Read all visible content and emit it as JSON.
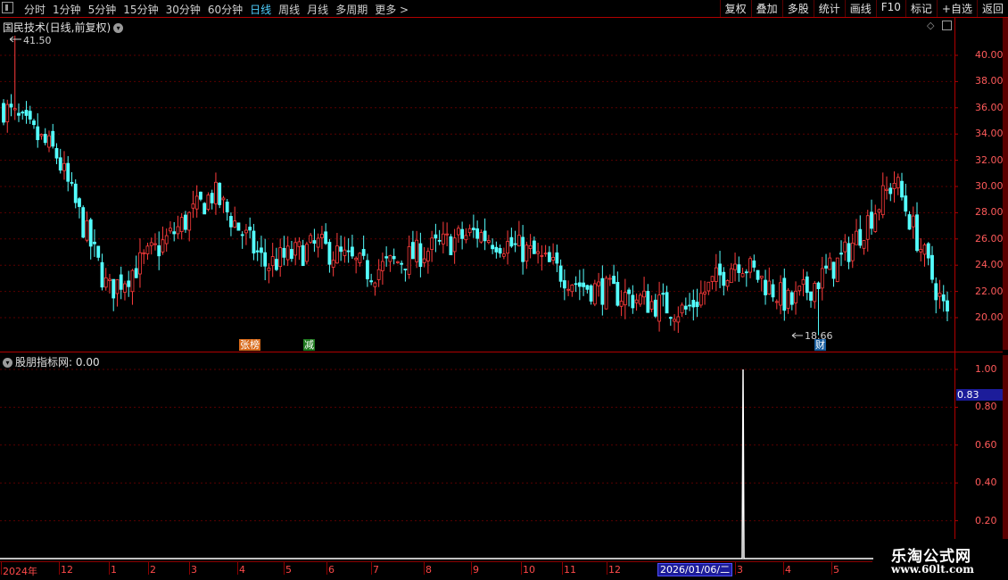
{
  "toolbar": {
    "periods": [
      "分时",
      "1分钟",
      "5分钟",
      "15分钟",
      "30分钟",
      "60分钟",
      "日线",
      "周线",
      "月线",
      "多周期",
      "更多 >"
    ],
    "active_period": "日线",
    "tools": [
      "复权",
      "叠加",
      "多股",
      "统计",
      "画线",
      "F10",
      "标记",
      "+自选",
      "返回"
    ]
  },
  "main_chart": {
    "title": "国民技术(日线,前复权)",
    "high_label": "41.50",
    "low_label": "18.66",
    "y_ticks": [
      "40.00",
      "38.00",
      "36.00",
      "34.00",
      "32.00",
      "30.00",
      "28.00",
      "26.00",
      "24.00",
      "22.00",
      "20.00"
    ],
    "badges": [
      "张榜",
      "减",
      "财"
    ]
  },
  "indicator": {
    "title": "股朋指标网",
    "value_text": ": 0.00",
    "current_label": "0.83",
    "y_ticks": [
      "1.00",
      "0.80",
      "0.60",
      "0.40",
      "0.20"
    ]
  },
  "date_axis": {
    "labels": [
      "2024年",
      "12",
      "1",
      "2",
      "3",
      "4",
      "5",
      "6",
      "7",
      "8",
      "9",
      "10",
      "11",
      "12",
      "3",
      "4",
      "5"
    ],
    "selected_date": "2026/01/06/二"
  },
  "watermark": {
    "line1": "乐淘公式网",
    "line2": "www.60lt.com"
  },
  "colors": {
    "up": "#ff3c3c",
    "down": "#54ffff",
    "axis": "#b00000",
    "grid": "#5a0000",
    "active": "#4fd0ff"
  },
  "chart_data": [
    {
      "type": "candlestick",
      "title": "国民技术(日线,前复权)",
      "y_range": [
        18.66,
        41.5
      ],
      "annotations": [
        {
          "label": "41.50",
          "kind": "high"
        },
        {
          "label": "18.66",
          "kind": "low"
        }
      ],
      "close_path": [
        {
          "month": "2024-11",
          "close": 36.0
        },
        {
          "month": "2024-12",
          "close": 32.5
        },
        {
          "month": "2025-01",
          "close": 22.0
        },
        {
          "month": "2025-02",
          "close": 25.5
        },
        {
          "month": "2025-03",
          "close": 29.5
        },
        {
          "month": "2025-04",
          "close": 24.0
        },
        {
          "month": "2025-05",
          "close": 25.5
        },
        {
          "month": "2025-06",
          "close": 23.5
        },
        {
          "month": "2025-07",
          "close": 25.0
        },
        {
          "month": "2025-08",
          "close": 26.5
        },
        {
          "month": "2025-09",
          "close": 25.0
        },
        {
          "month": "2025-10",
          "close": 22.5
        },
        {
          "month": "2025-11",
          "close": 21.5
        },
        {
          "month": "2025-12",
          "close": 20.5
        },
        {
          "month": "2026-01",
          "close": 24.5
        },
        {
          "month": "2026-03",
          "close": 21.0
        },
        {
          "month": "2026-04",
          "close": 24.5
        },
        {
          "month": "2026-05",
          "close": 30.5
        },
        {
          "month": "2026-06",
          "close": 20.0
        }
      ]
    },
    {
      "type": "line",
      "title": "股朋指标网",
      "y_range": [
        0,
        1.0
      ],
      "x": [
        "2026/01/06"
      ],
      "values": [
        1.0
      ],
      "baseline": 0.0,
      "current_label": "0.83"
    }
  ]
}
